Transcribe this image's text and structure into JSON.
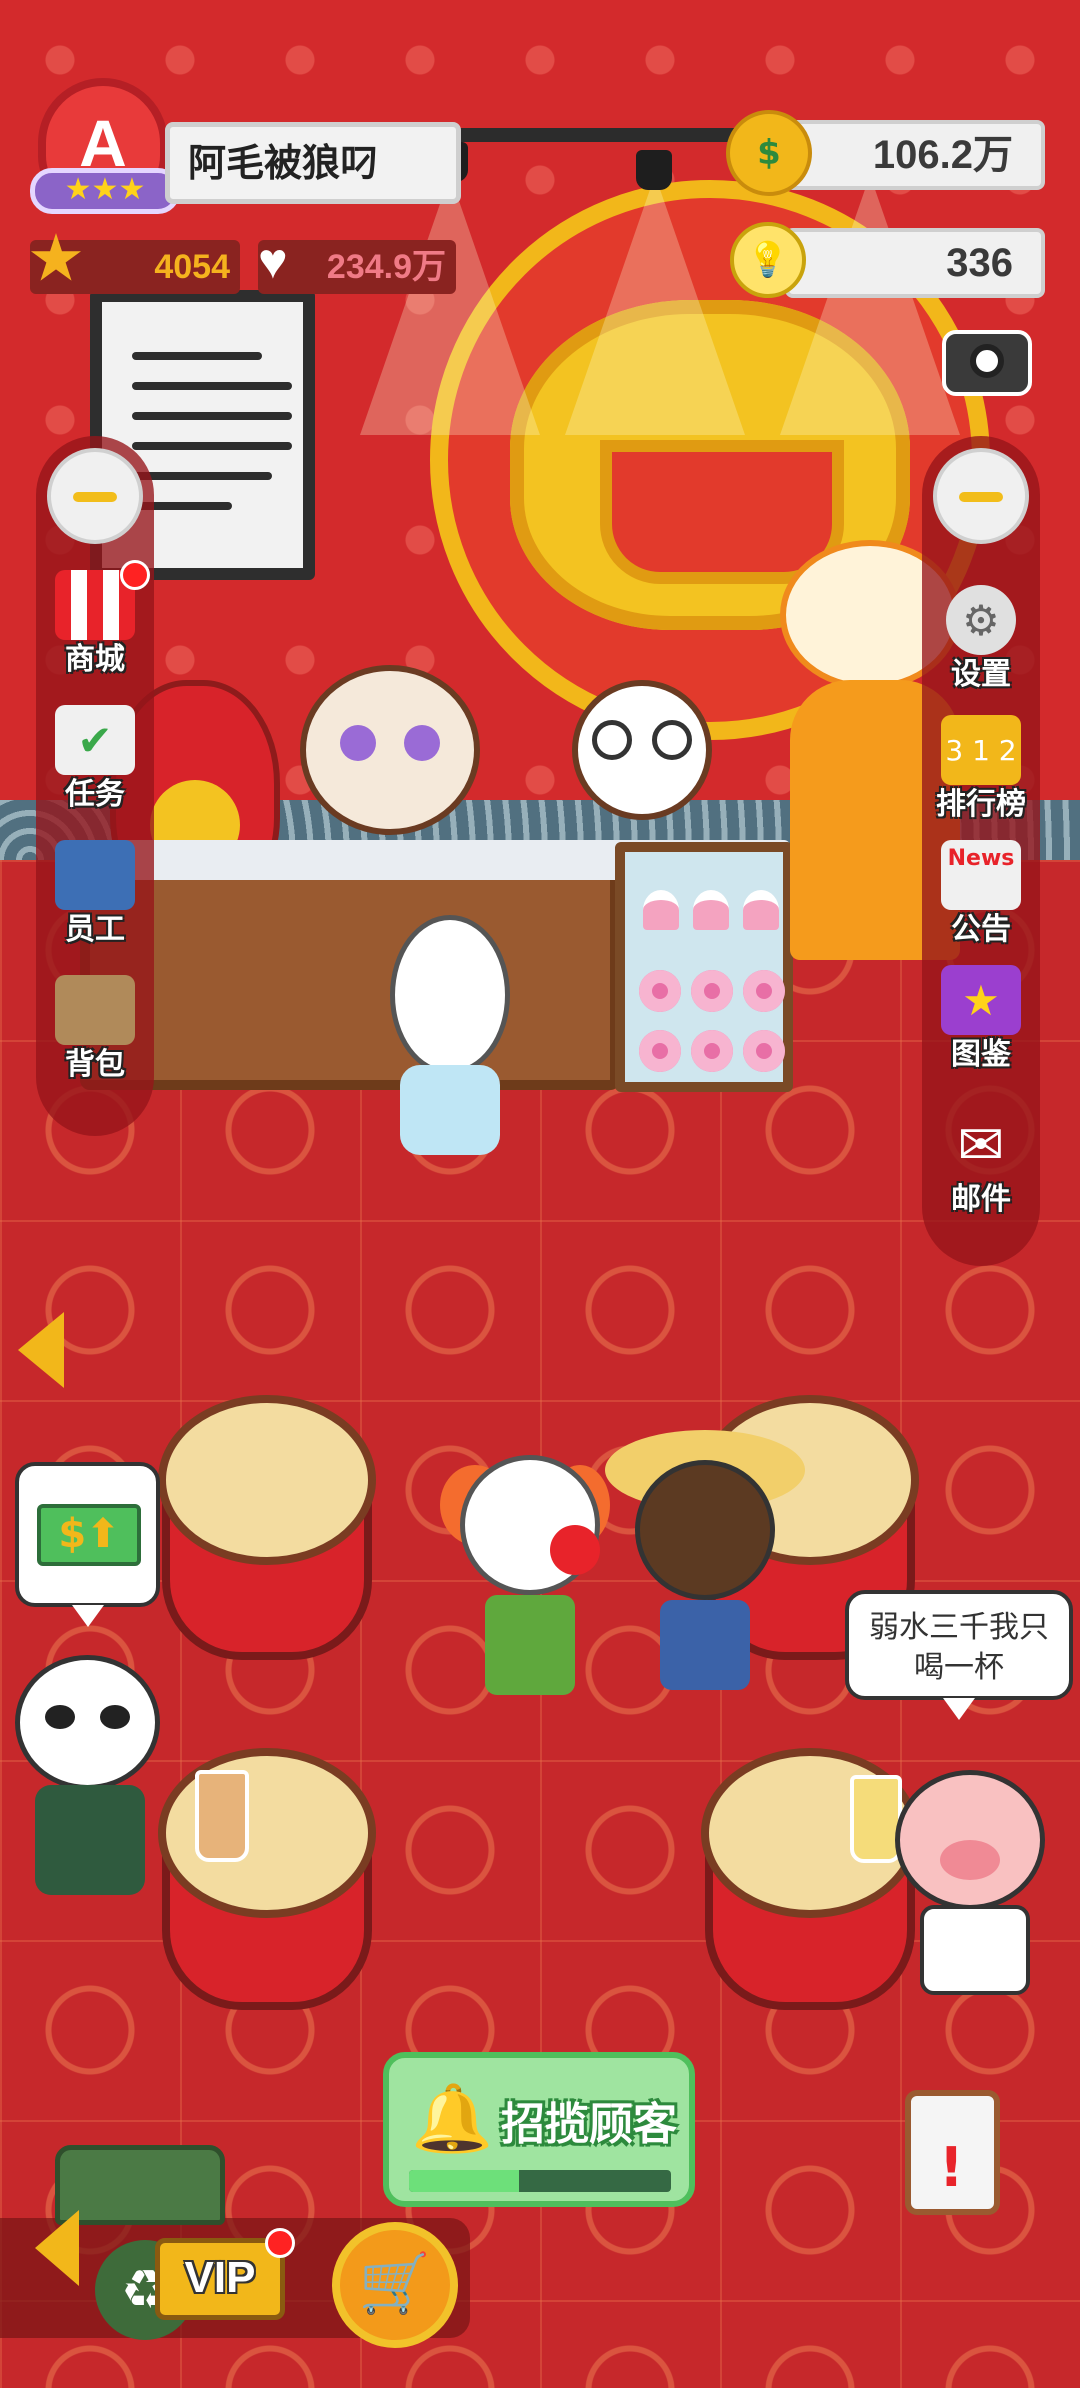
{
  "player": {
    "level_letter": "A",
    "level_stars": "★★★",
    "name": "阿毛被狼叼",
    "stars": "4054",
    "hearts": "234.9万"
  },
  "resources": {
    "cash": "106.2万",
    "ideas": "336"
  },
  "left_menu": [
    {
      "label": "商城",
      "icon": "shop-icon",
      "has_badge": true
    },
    {
      "label": "任务",
      "icon": "task-icon",
      "has_badge": false
    },
    {
      "label": "员工",
      "icon": "staff-icon",
      "has_badge": false
    },
    {
      "label": "背包",
      "icon": "backpack-icon",
      "has_badge": false
    }
  ],
  "right_menu": [
    {
      "label": "设置",
      "icon": "gear-icon"
    },
    {
      "label": "排行榜",
      "icon": "podium-icon"
    },
    {
      "label": "公告",
      "icon": "news-icon",
      "badge_text": "News"
    },
    {
      "label": "图鉴",
      "icon": "collection-icon"
    },
    {
      "label": "邮件",
      "icon": "mail-icon"
    }
  ],
  "speech": {
    "pig": "弱水三千我只喝一杯"
  },
  "bottom": {
    "vip_label": "VIP",
    "recruit_label": "招揽顾客",
    "recruit_progress": 0.42
  },
  "colors": {
    "accent_gold": "#f2b71a",
    "brand_red": "#d32a2c",
    "recruit_green": "#4fbf5c"
  }
}
